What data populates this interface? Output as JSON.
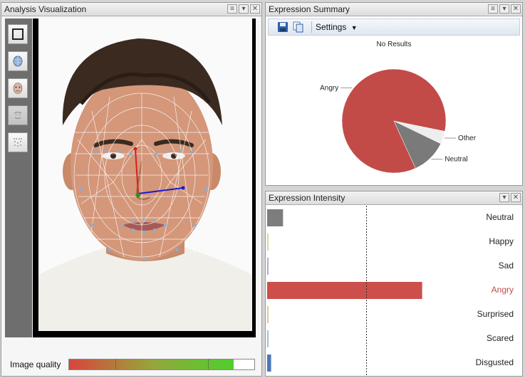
{
  "panels": {
    "left": {
      "title": "Analysis Visualization"
    },
    "summary": {
      "title": "Expression Summary",
      "settings_label": "Settings",
      "chart_title": "No Results"
    },
    "intensity": {
      "title": "Expression Intensity"
    }
  },
  "window_buttons": {
    "pin": "≡",
    "dropdown": "▾",
    "close": "✕"
  },
  "image_quality": {
    "label": "Image quality",
    "value": 0.89
  },
  "chart_data": [
    {
      "type": "pie",
      "title": "No Results",
      "slices": [
        {
          "label": "Angry",
          "value": 85,
          "color": "#c24b48"
        },
        {
          "label": "Other",
          "value": 4,
          "color": "#eeeeee"
        },
        {
          "label": "Neutral",
          "value": 11,
          "color": "#7a7a7a"
        }
      ]
    },
    {
      "type": "bar",
      "orientation": "horizontal",
      "categories": [
        "Neutral",
        "Happy",
        "Sad",
        "Angry",
        "Surprised",
        "Scared",
        "Disgusted"
      ],
      "values": [
        0.08,
        0.0,
        0.0,
        0.78,
        0.0,
        0.0,
        0.02
      ],
      "colors": [
        "#7d7d7d",
        "#d8d89a",
        "#b9a8d6",
        "#cc4f4c",
        "#e2c99a",
        "#9fc0e0",
        "#4c78b8"
      ],
      "highlight": "Angry",
      "highlight_color": "#c24b48",
      "xlim": [
        0,
        1
      ],
      "reference_line": 0.5
    }
  ]
}
